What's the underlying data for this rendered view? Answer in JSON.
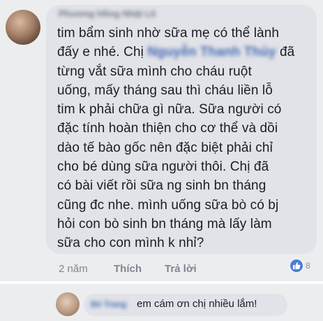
{
  "comment": {
    "author": "Phương Hồng Nhật Lê",
    "lines": [
      "tim bẩm sinh nhờ sữa mẹ có thể lành",
      "đấy e nhé. Chị ",
      "từng vắt sữa mình cho cháu ruột",
      "uống, mấy tháng sau thì cháu liền lỗ",
      "tim k phải chữa gì nữa. Sữa người có",
      "đặc tính hoàn thiện cho cơ thể và dồi",
      "dào tế bào gốc nên đặc biệt phải chỉ",
      "cho bé dùng sữa người thôi.  Chị đã",
      "có bài viết rồi sữa ng sinh bn tháng",
      "cũng đc nhe. mình uống sữa bò có bj",
      "hỏi con bò sinh bn tháng mà lấy làm",
      "sữa cho con mình k nhỉ?"
    ],
    "tagged_name": "Nguyễn Thanh Thủy",
    "line2_suffix": " đã",
    "time_ago": "2 năm",
    "like_label": "Thích",
    "reply_label": "Trả lời",
    "reaction_count": "8",
    "reaction_icon": "like-thumb-icon",
    "reaction_color": "#4a7fd4"
  },
  "reply": {
    "author": "Bé Trang",
    "text": "em cám ơn chị nhiều lắm!"
  }
}
